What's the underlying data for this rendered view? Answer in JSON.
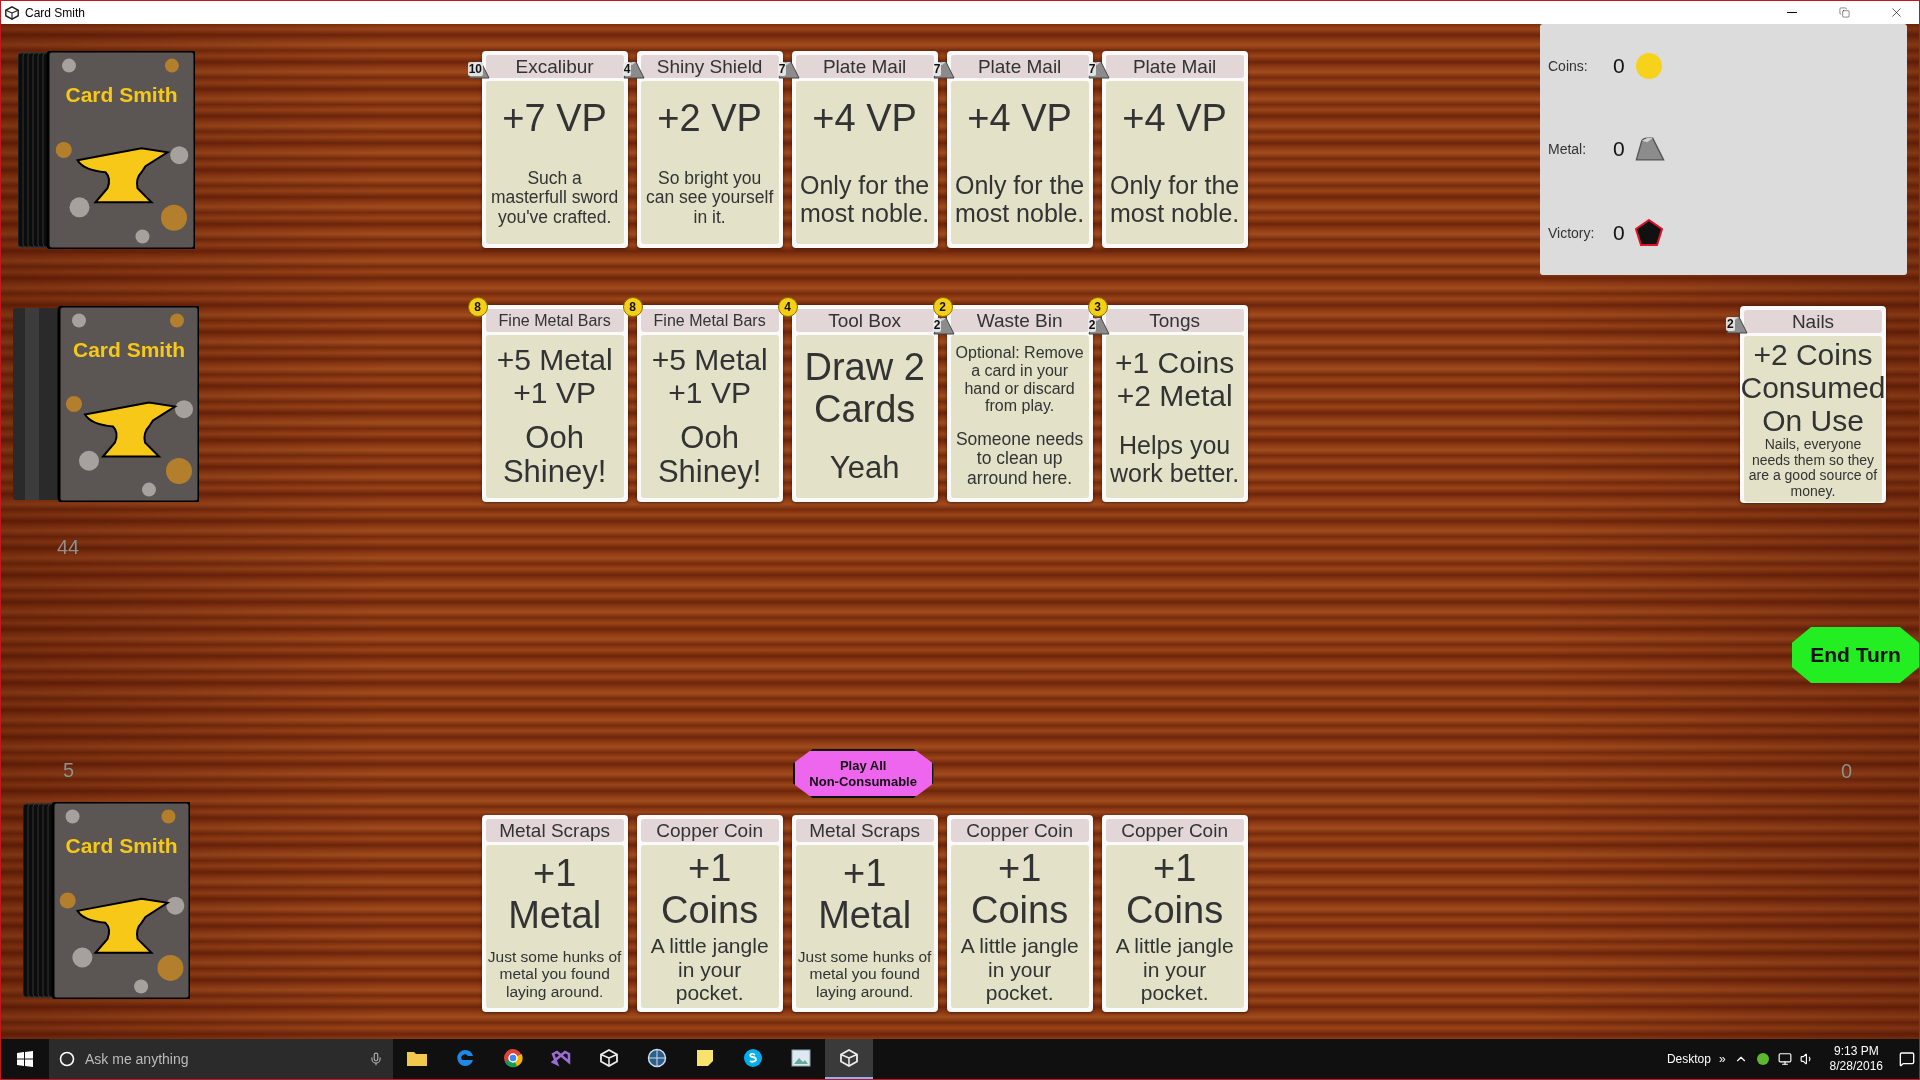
{
  "window": {
    "title": "Card Smith"
  },
  "decks": [
    {
      "kind": "fanned",
      "back_title": "Card Smith"
    },
    {
      "kind": "thick",
      "back_title": "Card Smith",
      "count": "44"
    },
    {
      "kind": "fanned",
      "back_title": "Card Smith",
      "count": "5"
    }
  ],
  "market_rows": [
    [
      {
        "title": "Excalibur",
        "effect": "+7 VP",
        "flavor": "Such a masterfull sword you've crafted.",
        "metal_cost": "10"
      },
      {
        "title": "Shiny Shield",
        "effect": "+2 VP",
        "flavor": "So bright you can see yourself in it.",
        "metal_cost": "4"
      },
      {
        "title": "Plate Mail",
        "effect": "+4 VP",
        "flavor": "Only for the most noble.",
        "metal_cost": "7"
      },
      {
        "title": "Plate Mail",
        "effect": "+4 VP",
        "flavor": "Only for the most noble.",
        "metal_cost": "7"
      },
      {
        "title": "Plate Mail",
        "effect": "+4 VP",
        "flavor": "Only for the most noble.",
        "metal_cost": "7"
      }
    ],
    [
      {
        "title": "Fine Metal Bars",
        "effect": "+5 Metal +1 VP",
        "flavor": "Ooh Shiney!",
        "coin_cost": "8"
      },
      {
        "title": "Fine Metal Bars",
        "effect": "+5 Metal +1 VP",
        "flavor": "Ooh Shiney!",
        "coin_cost": "8"
      },
      {
        "title": "Tool Box",
        "effect": "Draw 2 Cards",
        "flavor": "Yeah",
        "coin_cost": "4"
      },
      {
        "title": "Waste Bin",
        "effect": "Optional: Remove a card in your hand or discard from play.",
        "flavor": "Someone needs to clean up arround here.",
        "coin_cost": "2",
        "metal_cost": "2"
      },
      {
        "title": "Tongs",
        "effect": "+1 Coins +2 Metal",
        "flavor": "Helps you work better.",
        "coin_cost": "3",
        "metal_cost": "2"
      }
    ]
  ],
  "play_all_button": "Play All Non-Consumable",
  "hand": [
    {
      "title": "Metal Scraps",
      "effect": "+1 Metal",
      "flavor": "Just some hunks of metal you found laying around."
    },
    {
      "title": "Copper Coin",
      "effect": "+1 Coins",
      "flavor": "A little jangle in your pocket."
    },
    {
      "title": "Metal Scraps",
      "effect": "+1 Metal",
      "flavor": "Just some hunks of metal you found laying around."
    },
    {
      "title": "Copper Coin",
      "effect": "+1 Coins",
      "flavor": "A little jangle in your pocket."
    },
    {
      "title": "Copper Coin",
      "effect": "+1 Coins",
      "flavor": "A little jangle in your pocket."
    }
  ],
  "stats": [
    {
      "kind": "coins",
      "label": "Coins:",
      "value": "0"
    },
    {
      "kind": "metal",
      "label": "Metal:",
      "value": "0"
    },
    {
      "kind": "victory",
      "label": "Victory:",
      "value": "0"
    }
  ],
  "side_card": {
    "title": "Nails",
    "effect": "+2 Coins Consumed On Use",
    "flavor": "Nails, everyone needs them so they are a good source of money.",
    "metal_cost": "2"
  },
  "end_turn_button": "End Turn",
  "discard_count": "0",
  "taskbar": {
    "search_placeholder": "Ask me anything",
    "apps": [
      {
        "kind": "folder",
        "selected": false
      },
      {
        "kind": "edge",
        "selected": false
      },
      {
        "kind": "chrome",
        "selected": false
      },
      {
        "kind": "studio",
        "selected": false
      },
      {
        "kind": "unity",
        "selected": false
      },
      {
        "kind": "globe",
        "selected": false
      },
      {
        "kind": "notes",
        "selected": false
      },
      {
        "kind": "skype",
        "selected": false
      },
      {
        "kind": "photo",
        "selected": false
      },
      {
        "kind": "unity",
        "selected": true
      }
    ],
    "desktop_label": "Desktop",
    "chevron": "»",
    "time": "9:13 PM",
    "date": "8/28/2016"
  }
}
